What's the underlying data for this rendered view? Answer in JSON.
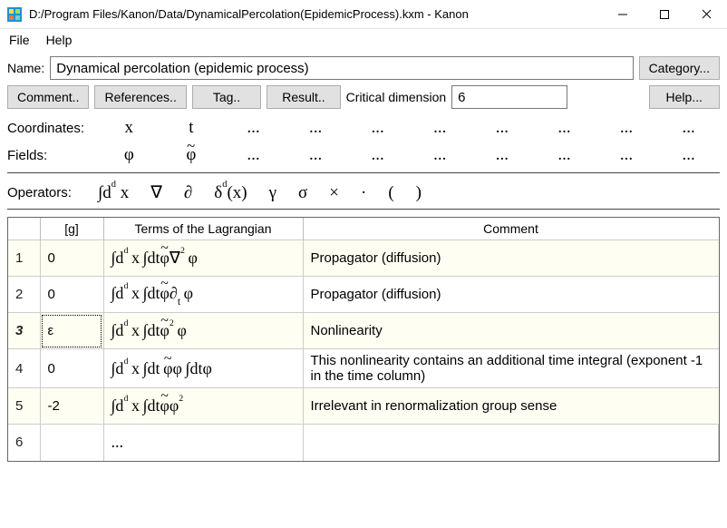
{
  "window": {
    "title": "D:/Program Files/Kanon/Data/DynamicalPercolation(EpidemicProcess).kxm - Kanon"
  },
  "menu": {
    "file": "File",
    "help": "Help"
  },
  "form": {
    "name_label": "Name:",
    "name_value": "Dynamical percolation (epidemic process)",
    "category_btn": "Category...",
    "comment_btn": "Comment..",
    "references_btn": "References..",
    "tag_btn": "Tag..",
    "result_btn": "Result..",
    "critdim_label": "Critical dimension",
    "critdim_value": "6",
    "help_btn": "Help..."
  },
  "rows": {
    "coords_label": "Coordinates:",
    "coords": [
      "x",
      "t",
      "...",
      "...",
      "...",
      "...",
      "...",
      "...",
      "...",
      "..."
    ],
    "fields_label": "Fields:",
    "fields_phi": "φ",
    "fields_phit": "φ",
    "fields_dots": "...",
    "ops_label": "Operators:"
  },
  "ops": {
    "int": "∫d",
    "int_sup": "d",
    "int_x": " x",
    "nabla": "∇",
    "partial": "∂",
    "delta": "δ",
    "delta_sup": "d",
    "delta_x": "(x)",
    "gamma": "γ",
    "sigma": "σ",
    "times": "×",
    "dot": "·",
    "lparen": "(",
    "rparen": ")"
  },
  "table": {
    "head_g": "[g]",
    "head_terms": "Terms of the Lagrangian",
    "head_comment": "Comment",
    "rows": [
      {
        "n": "1",
        "g": "0",
        "comment": "Propagator (diffusion)"
      },
      {
        "n": "2",
        "g": "0",
        "comment": "Propagator (diffusion)"
      },
      {
        "n": "3",
        "g": "ε",
        "comment": "Nonlinearity"
      },
      {
        "n": "4",
        "g": "0",
        "comment": "This nonlinearity contains an additional time integral (exponent -1 in the time column)"
      },
      {
        "n": "5",
        "g": "-2",
        "comment": "Irrelevant in renormalization group sense"
      },
      {
        "n": "6",
        "g": "",
        "comment": ""
      }
    ],
    "ellipsis": "..."
  }
}
